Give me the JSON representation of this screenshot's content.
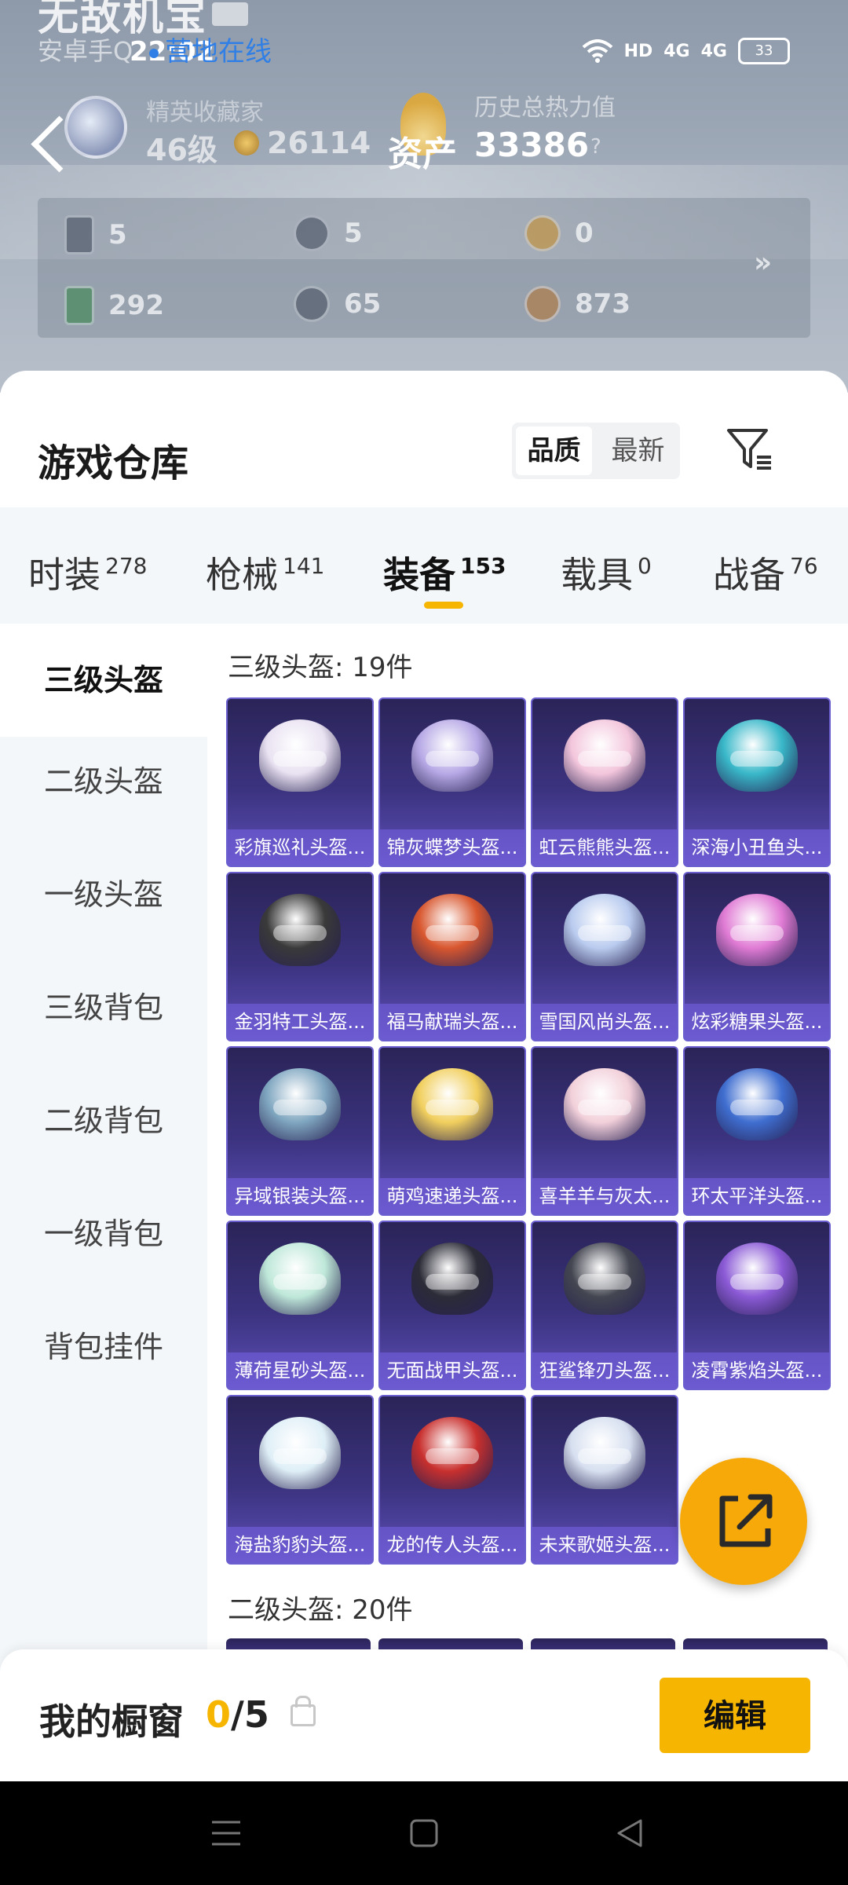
{
  "header": {
    "game_title": "无敌机宝",
    "sub_left": "安卓手Q",
    "time": "22:02",
    "online_status": "营地在线",
    "battery": "33",
    "signal_labels": [
      "HD",
      "4G",
      "4G"
    ],
    "rank_title": "精英收藏家",
    "level": "46级",
    "coins": "26114",
    "history_label": "历史总热力值",
    "assets_label": "资产",
    "assets_value": "33386",
    "help": "?",
    "more": "»",
    "resources": [
      {
        "icon": "card-icon",
        "value": "5"
      },
      {
        "icon": "silver-coin-icon",
        "value": "5"
      },
      {
        "icon": "gold-badge-icon",
        "value": "0"
      },
      {
        "icon": "green-card-icon",
        "value": "292"
      },
      {
        "icon": "gem-icon",
        "value": "65"
      },
      {
        "icon": "bronze-coin-icon",
        "value": "873"
      }
    ]
  },
  "warehouse": {
    "title": "游戏仓库",
    "sort": {
      "quality": "品质",
      "newest": "最新"
    },
    "tabs": [
      {
        "label": "时装",
        "count": "278"
      },
      {
        "label": "枪械",
        "count": "141"
      },
      {
        "label": "装备",
        "count": "153"
      },
      {
        "label": "载具",
        "count": "0"
      },
      {
        "label": "战备",
        "count": "76"
      }
    ],
    "side": [
      "三级头盔",
      "二级头盔",
      "一级头盔",
      "三级背包",
      "二级背包",
      "一级背包",
      "背包挂件"
    ],
    "section1": "三级头盔: 19件",
    "section2": "二级头盔: 20件",
    "items": [
      {
        "label": "彩旗巡礼头盔...",
        "color": "#e9e2f2"
      },
      {
        "label": "锦灰蝶梦头盔...",
        "color": "#b7a9e6"
      },
      {
        "label": "虹云熊熊头盔...",
        "color": "#f3c6dc"
      },
      {
        "label": "深海小丑鱼头...",
        "color": "#39b8c9"
      },
      {
        "label": "金羽特工头盔...",
        "color": "#3a3a3a"
      },
      {
        "label": "福马献瑞头盔...",
        "color": "#d8572f"
      },
      {
        "label": "雪国风尚头盔...",
        "color": "#b9cbef"
      },
      {
        "label": "炫彩糖果头盔...",
        "color": "#e07bd4"
      },
      {
        "label": "异域银装头盔...",
        "color": "#7fa6c0"
      },
      {
        "label": "萌鸡速递头盔...",
        "color": "#f1cf5e"
      },
      {
        "label": "喜羊羊与灰太...",
        "color": "#f2d0da"
      },
      {
        "label": "环太平洋头盔...",
        "color": "#3f6ed0"
      },
      {
        "label": "薄荷星砂头盔...",
        "color": "#bfe8d9"
      },
      {
        "label": "无面战甲头盔...",
        "color": "#2c2c38"
      },
      {
        "label": "狂鲨锋刃头盔...",
        "color": "#444651"
      },
      {
        "label": "凌霄紫焰头盔...",
        "color": "#8b5ad6"
      },
      {
        "label": "海盐豹豹头盔...",
        "color": "#dfeff7"
      },
      {
        "label": "龙的传人头盔...",
        "color": "#c8302e"
      },
      {
        "label": "未来歌姬头盔...",
        "color": "#d7e0f0"
      }
    ]
  },
  "showcase": {
    "title": "我的橱窗",
    "count_now": "0",
    "count_total": "/5",
    "edit": "编辑"
  },
  "colors": {
    "accent": "#f6b500",
    "fab": "#f7a90a",
    "online": "#2f7fe6"
  }
}
